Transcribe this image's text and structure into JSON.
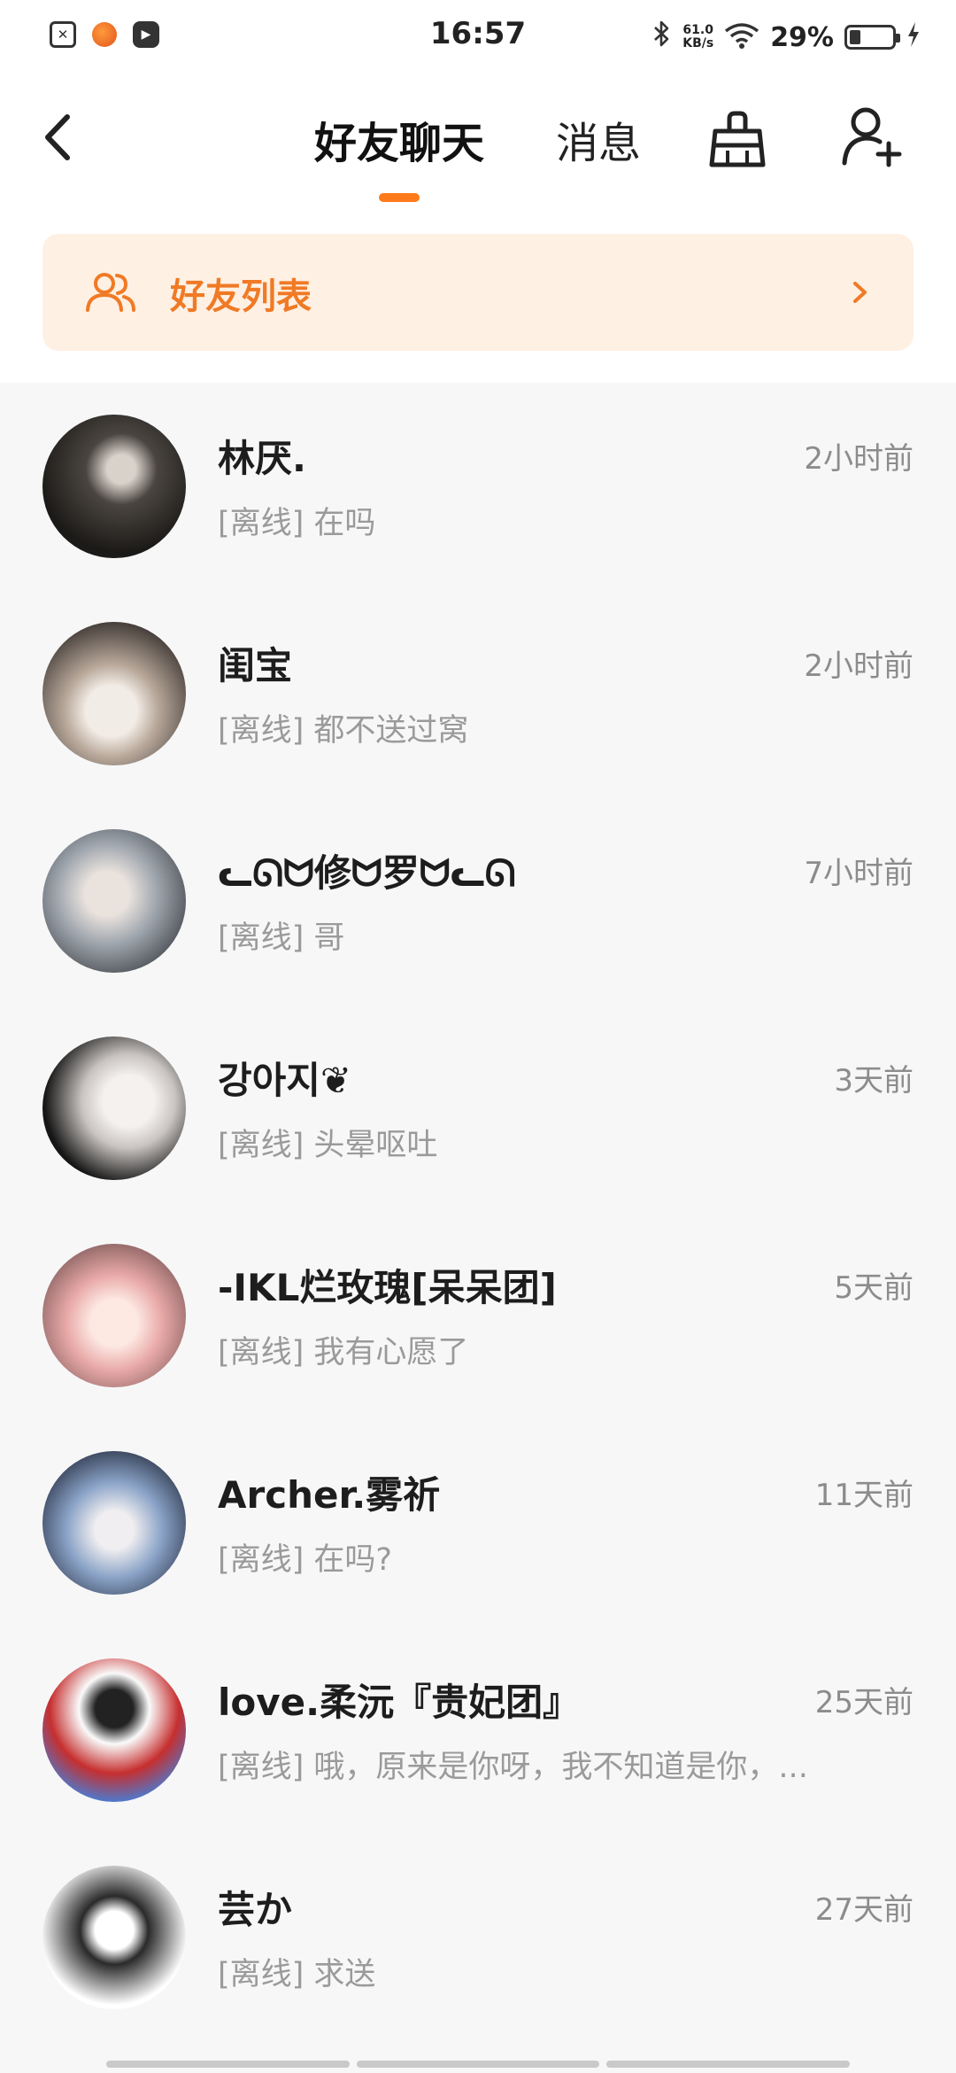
{
  "status_bar": {
    "time": "16:57",
    "net_speed_value": "61.0",
    "net_speed_unit": "KB/s",
    "battery_percent": "29%",
    "icons": [
      "notification-x-icon",
      "app-badge-icon",
      "video-player-icon",
      "bluetooth-icon",
      "wifi-icon",
      "battery-icon",
      "charging-icon"
    ]
  },
  "header": {
    "tabs": [
      {
        "label": "好友聊天",
        "active": true
      },
      {
        "label": "消息",
        "active": false
      }
    ],
    "accent_color": "#ff7a1a",
    "icons": [
      "back-icon",
      "clean-brush-icon",
      "add-friend-icon"
    ]
  },
  "friend_banner": {
    "label": "好友列表",
    "icon": "friends-icon",
    "bg_color": "#fff0e4",
    "text_color": "#f07a25"
  },
  "chats": [
    {
      "name": "林厌.",
      "time": "2小时前",
      "preview": "[离线] 在吗"
    },
    {
      "name": "闺宝",
      "time": "2小时前",
      "preview": "[离线] 都不送过窝"
    },
    {
      "name": "ᓚᘏᗢ修ᗢ罗ᗢᓚᘏ",
      "time": "7小时前",
      "preview": "[离线] 哥"
    },
    {
      "name": "강아지❦",
      "time": "3天前",
      "preview": "[离线] 头晕呕吐"
    },
    {
      "name": "-IKL烂玫瑰[呆呆团]",
      "time": "5天前",
      "preview": "[离线] 我有心愿了"
    },
    {
      "name": "Archer.雾祈",
      "time": "11天前",
      "preview": "[离线] 在吗?"
    },
    {
      "name": "love.柔沅『贵妃团』",
      "time": "25天前",
      "preview": "[离线] 哦，原来是你呀，我不知道是你，..."
    },
    {
      "name": "芸か",
      "time": "27天前",
      "preview": "[离线] 求送"
    }
  ]
}
